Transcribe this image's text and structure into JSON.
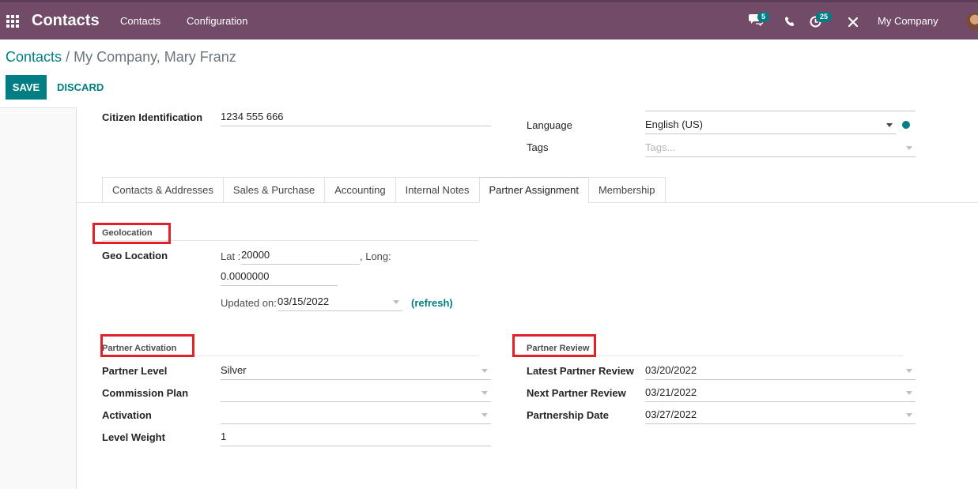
{
  "navbar": {
    "app_name": "Contacts",
    "menus": [
      "Contacts",
      "Configuration"
    ],
    "messages_badge": "5",
    "activities_badge": "25",
    "company": "My Company",
    "color": "#714b67"
  },
  "breadcrumb": {
    "parent": "Contacts",
    "separator": "/",
    "current": "My Company, Mary Franz"
  },
  "buttons": {
    "save": "SAVE",
    "discard": "DISCARD"
  },
  "header_fields": {
    "citizen_label": "Citizen Identification",
    "citizen_value": "1234 555 666",
    "language_label": "Language",
    "language_value": "English (US)",
    "tags_label": "Tags",
    "tags_placeholder": "Tags..."
  },
  "tabs": [
    "Contacts & Addresses",
    "Sales & Purchase",
    "Accounting",
    "Internal Notes",
    "Partner Assignment",
    "Membership"
  ],
  "active_tab": "Partner Assignment",
  "geolocation": {
    "title": "Geolocation",
    "label": "Geo Location",
    "lat_prefix": "Lat :",
    "lat_value": "20000",
    "long_prefix": ", Long:",
    "long_value": "0.0000000",
    "updated_prefix": "Updated on:",
    "updated_value": "03/15/2022",
    "refresh": "(refresh)"
  },
  "partner_activation": {
    "title": "Partner Activation",
    "level_label": "Partner Level",
    "level_value": "Silver",
    "commission_label": "Commission Plan",
    "commission_value": "",
    "activation_label": "Activation",
    "activation_value": "",
    "weight_label": "Level Weight",
    "weight_value": "1"
  },
  "partner_review": {
    "title": "Partner Review",
    "latest_label": "Latest Partner Review",
    "latest_value": "03/20/2022",
    "next_label": "Next Partner Review",
    "next_value": "03/21/2022",
    "date_label": "Partnership Date",
    "date_value": "03/27/2022"
  },
  "colors": {
    "accent": "#017e84",
    "highlight": "#e0212a"
  }
}
